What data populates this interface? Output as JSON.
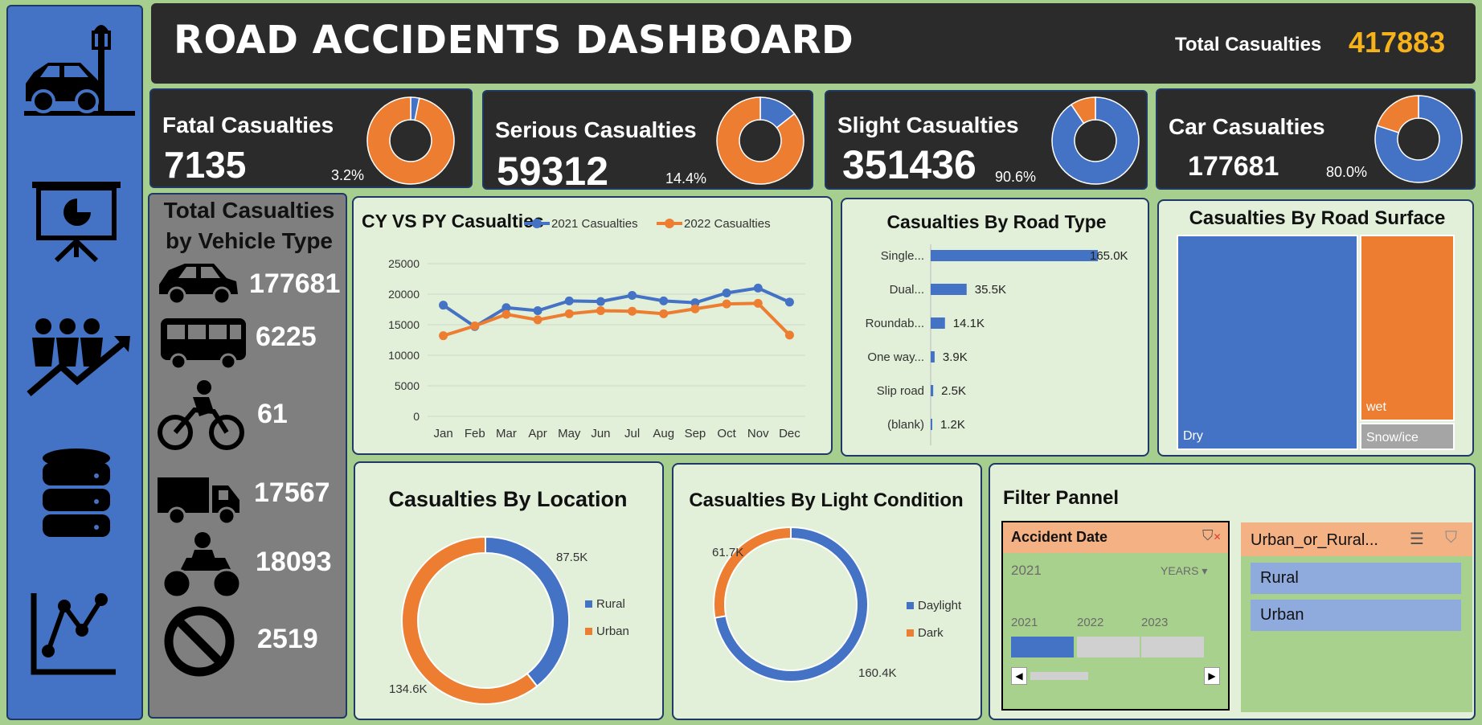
{
  "header": {
    "title": "ROAD ACCIDENTS DASHBOARD",
    "total_label": "Total Casualties",
    "total_value": "417883"
  },
  "sidebar": {
    "icons": [
      "car-crash-icon",
      "presentation-icon",
      "people-growth-icon",
      "database-icon",
      "line-chart-icon"
    ]
  },
  "kpis": {
    "fatal": {
      "label": "Fatal Casualties",
      "value": "7135",
      "pct": "3.2%",
      "fraction": 0.032
    },
    "serious": {
      "label": "Serious Casualties",
      "value": "59312",
      "pct": "14.4%",
      "fraction": 0.144
    },
    "slight": {
      "label": "Slight Casualties",
      "value": "351436",
      "pct": "90.6%",
      "fraction": 0.906
    },
    "car": {
      "label": "Car Casualties",
      "value": "177681",
      "pct": "80.0%",
      "fraction": 0.8
    }
  },
  "vehicle": {
    "title_line1": "Total Casualties",
    "title_line2": "by Vehicle Type",
    "items": [
      {
        "icon": "car-icon",
        "value": "177681"
      },
      {
        "icon": "bus-icon",
        "value": "6225"
      },
      {
        "icon": "bicycle-icon",
        "value": "61"
      },
      {
        "icon": "truck-icon",
        "value": "17567"
      },
      {
        "icon": "motorcycle-icon",
        "value": "18093"
      },
      {
        "icon": "prohibited-icon",
        "value": "2519"
      }
    ]
  },
  "colors": {
    "blue": "#4472c4",
    "orange": "#ed7d31",
    "gray": "#a5a5a5",
    "gold": "#f6b21b"
  },
  "chart_data": [
    {
      "type": "line",
      "title": "CY VS PY Casualties",
      "categories": [
        "Jan",
        "Feb",
        "Mar",
        "Apr",
        "May",
        "Jun",
        "Jul",
        "Aug",
        "Sep",
        "Oct",
        "Nov",
        "Dec"
      ],
      "series": [
        {
          "name": "2021 Casualties",
          "values": [
            18200,
            14700,
            17800,
            17300,
            18900,
            18800,
            19800,
            18900,
            18600,
            20200,
            21000,
            18700
          ]
        },
        {
          "name": "2022 Casualties",
          "values": [
            13200,
            14800,
            16700,
            15800,
            16800,
            17300,
            17200,
            16800,
            17600,
            18400,
            18500,
            13300
          ]
        }
      ],
      "ylim": [
        0,
        25000
      ],
      "yticks": [
        "25000",
        "20000",
        "15000",
        "10000",
        "5000",
        "0"
      ],
      "legend": "top",
      "grid": true
    },
    {
      "type": "bar",
      "orientation": "horizontal",
      "title": "Casualties By Road Type",
      "categories": [
        "Single...",
        "Dual...",
        "Roundab...",
        "One way...",
        "Slip road",
        "(blank)"
      ],
      "values": [
        165.0,
        35.5,
        14.1,
        3.9,
        2.5,
        1.2
      ],
      "labels": [
        "165.0K",
        "35.5K",
        "14.1K",
        "3.9K",
        "2.5K",
        "1.2K"
      ]
    },
    {
      "type": "treemap",
      "title": "Casualties By Road Surface",
      "categories": [
        "Dry",
        "wet",
        "Snow/ice"
      ]
    },
    {
      "type": "pie",
      "title": "Casualties By Location",
      "categories": [
        "Rural",
        "Urban"
      ],
      "values": [
        87.5,
        134.6
      ],
      "labels": [
        "87.5K",
        "134.6K"
      ],
      "legend": "right"
    },
    {
      "type": "pie",
      "title": "Casualties By Light Condition",
      "categories": [
        "Daylight",
        "Dark"
      ],
      "values": [
        160.4,
        61.7
      ],
      "labels": [
        "160.4K",
        "61.7K"
      ],
      "legend": "right"
    }
  ],
  "filter": {
    "title": "Filter Pannel",
    "date_slicer": {
      "title": "Accident Date",
      "selected": "2021",
      "level": "YEARS",
      "years": [
        "2021",
        "2022",
        "2023"
      ]
    },
    "area_slicer": {
      "title": "Urban_or_Rural...",
      "options": [
        "Rural",
        "Urban"
      ]
    }
  }
}
